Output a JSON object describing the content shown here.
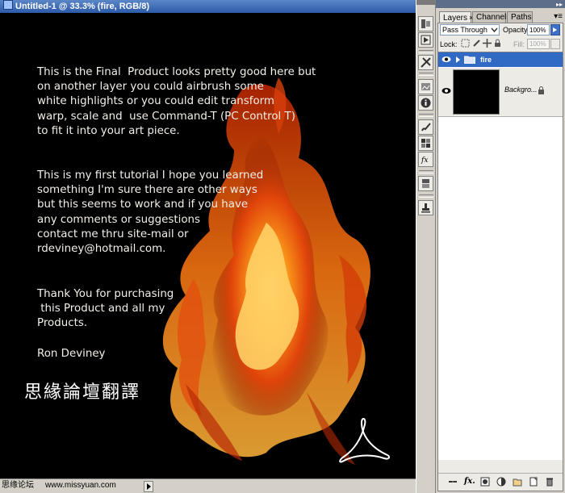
{
  "document": {
    "title": "Untitled-1 @ 33.3% (fire, RGB/8)",
    "paragraph1": "This is the Final  Product looks pretty good here but\non another layer you could airbrush some\nwhite highlights or you could edit transform\nwarp, scale and  use Command-T (PC Control T)\nto fit it into your art piece.",
    "paragraph2": "This is my first tutorial I hope you learned\nsomething I'm sure there are other ways\nbut this seems to work and if you have\nany comments or suggestions\ncontact me thru site-mail or\nrdeviney@hotmail.com.",
    "paragraph3": "Thank You for purchasing\n this Product and all my\nProducts.",
    "signature": "Ron Deviney",
    "watermark": "思緣論壇翻譯"
  },
  "statusbar": {
    "zoom": "思缘论坛",
    "site1": "www.missyuan.com",
    "site2": ""
  },
  "layers_panel": {
    "tabs": [
      {
        "label": "Layers",
        "active": true
      },
      {
        "label": "Channels",
        "active": false
      },
      {
        "label": "Paths",
        "active": false
      }
    ],
    "blend_mode": "Pass Through",
    "opacity_label": "Opacity:",
    "opacity_value": "100%",
    "lock_label": "Lock:",
    "fill_label": "Fill:",
    "fill_value": "100%",
    "layers": [
      {
        "name": "fire",
        "type": "group",
        "selected": true,
        "visible": true
      },
      {
        "name": "Backgro...",
        "type": "background",
        "selected": false,
        "visible": true,
        "locked": true
      }
    ]
  },
  "colors": {
    "selection": "#316ac5",
    "panel_bg": "#ecebe6",
    "fire_core": "#ffb000",
    "fire_edge": "#c22800"
  }
}
